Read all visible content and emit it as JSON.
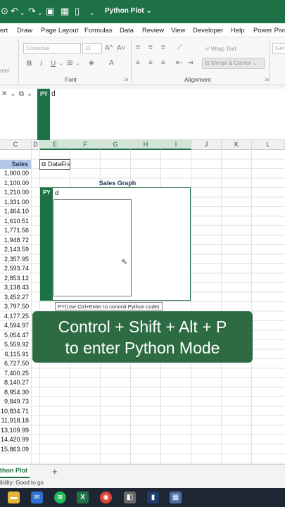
{
  "titlebar": {
    "title": "Python Plot",
    "chevron": "⌄",
    "quick_access": [
      {
        "icon": "save-icon",
        "glyph": "⊙"
      },
      {
        "icon": "undo-icon",
        "glyph": "↶"
      },
      {
        "icon": "undo-dropdown-icon",
        "glyph": "⌄"
      },
      {
        "icon": "redo-icon",
        "glyph": "↷"
      },
      {
        "icon": "redo-dropdown-icon",
        "glyph": "⌄"
      },
      {
        "icon": "floppy-save-icon",
        "glyph": "▣"
      },
      {
        "icon": "form-icon",
        "glyph": "▦"
      },
      {
        "icon": "new-file-icon",
        "glyph": "▯"
      },
      {
        "icon": "customize-dropdown-icon",
        "glyph": "⌄"
      }
    ]
  },
  "ribbon_tabs": [
    "ert",
    "Draw",
    "Page Layout",
    "Formulas",
    "Data",
    "Review",
    "View",
    "Developer",
    "Help",
    "Power Pivot"
  ],
  "ribbon": {
    "font_name": "Consolas",
    "font_size": "11",
    "wrap_text": "Wrap Text",
    "merge_center": "Merge & Center",
    "number_format": "Gen",
    "enter_label": "nter",
    "font_group": "Font",
    "alignment_group": "Alignment",
    "bold": "B",
    "italic": "I",
    "underline": "U",
    "grow_font": "A^",
    "shrink_font": "A˅"
  },
  "formula_bar": {
    "py_label": "PY",
    "content": "d"
  },
  "columns": [
    "C",
    "D",
    "E",
    "F",
    "G",
    "H",
    "I",
    "J",
    "K",
    "L"
  ],
  "sales": {
    "header": "Sales",
    "values": [
      "1,000.00",
      "1,100.00",
      "1,210.00",
      "1,331.00",
      "1,464.10",
      "1,610.51",
      "1,771.56",
      "1,948.72",
      "2,143.59",
      "2,357.95",
      "2,593.74",
      "2,853.12",
      "3,138.43",
      "3,452.27",
      "3,797.50",
      "4,177.25",
      "4,594.97",
      "5,054.47",
      "5,559.92",
      "6,115.91",
      "6,727.50",
      "7,400.25",
      "8,140.27",
      "8,954.30",
      "9,849.73",
      "10,834.71",
      "11,918.18",
      "13,109.99",
      "14,420.99",
      "15,863.09"
    ]
  },
  "dataframe_chip": "DataFrame",
  "sales_graph_title": "Sales Graph",
  "editor": {
    "py_label": "PY",
    "content": "d",
    "tooltip": "PY(Use Ctrl+Enter to commit Python code)"
  },
  "banner": {
    "line1": "Control + Shift + Alt + P",
    "line2": "to enter Python Mode"
  },
  "sheet": {
    "active_tab": "thon Plot",
    "add": "+"
  },
  "status": "ibility: Good to go",
  "taskbar": [
    "file-explorer-icon",
    "mail-icon",
    "spotify-icon",
    "excel-icon",
    "chrome-icon",
    "app-icon",
    "app-icon-2",
    "calculator-icon"
  ],
  "colors": {
    "excel_green": "#1e7145",
    "header_blue": "#b4c7e7",
    "banner_green": "#2d6b42"
  }
}
